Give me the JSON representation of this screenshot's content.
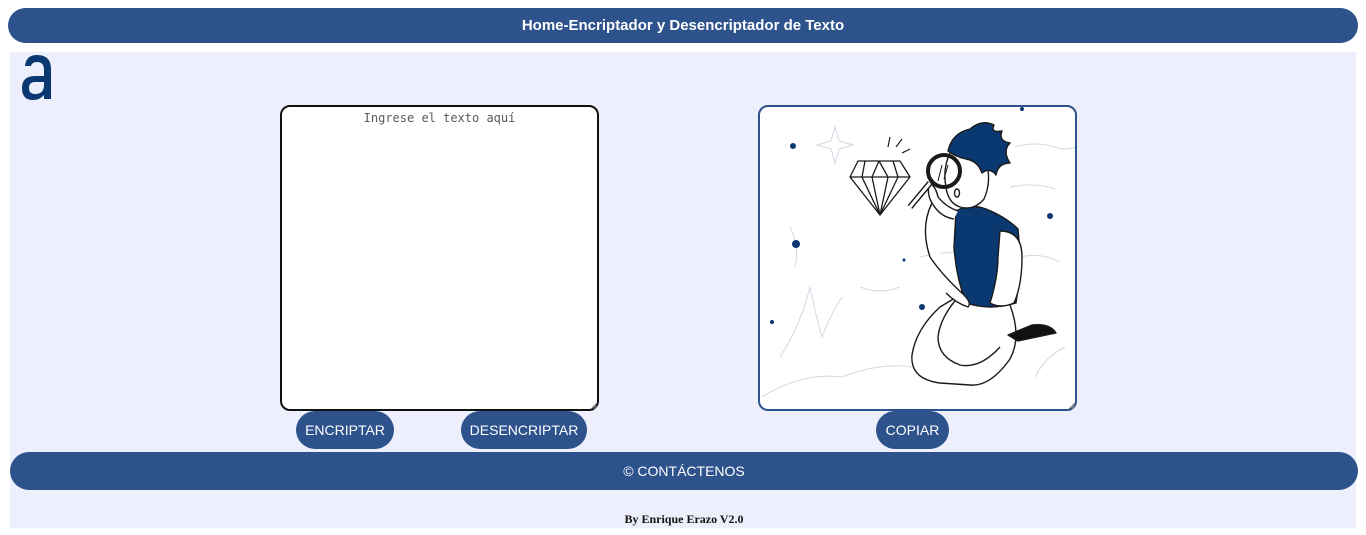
{
  "header": {
    "title": "Home-Encriptador y Desencriptador de Texto"
  },
  "logo": {
    "icon": "alura-logo-icon",
    "color": "#0a3871"
  },
  "input": {
    "placeholder": "Ingrese el texto aquí",
    "value": ""
  },
  "output": {
    "illustration": "person-with-magnifying-glass-illustration"
  },
  "buttons": {
    "encrypt_label": "ENCRIPTAR",
    "decrypt_label": "DESENCRIPTAR",
    "copy_label": "COPIAR"
  },
  "footer": {
    "contact_label": "© CONTÁCTENOS",
    "credit": "By Enrique Erazo V2.0"
  },
  "colors": {
    "primary": "#2d528c",
    "background": "#eeeffc",
    "accent_dark": "#0a3871"
  }
}
